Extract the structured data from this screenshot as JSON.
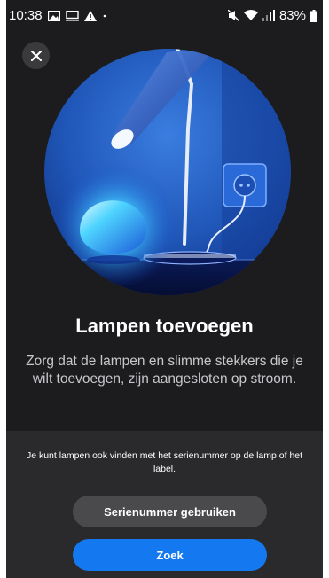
{
  "status_bar": {
    "time": "10:38",
    "battery": "83%",
    "icons": [
      "image-icon",
      "monitor-icon",
      "warning-icon",
      "mute-icon",
      "wifi-icon",
      "signal-icon",
      "battery-icon"
    ]
  },
  "header": {
    "close_icon": "close-icon"
  },
  "main": {
    "title": "Lampen toevoegen",
    "subtitle": "Zorg dat de lampen en slimme stekkers die je wilt toevoegen, zijn aangesloten op stroom."
  },
  "footer": {
    "hint": "Je kunt lampen ook vinden met het serienummer op de lamp of het label.",
    "serial_button": "Serienummer gebruiken",
    "search_button": "Zoek"
  },
  "colors": {
    "background": "#1c1c1e",
    "panel": "#2a2a2c",
    "accent": "#1479f0"
  }
}
